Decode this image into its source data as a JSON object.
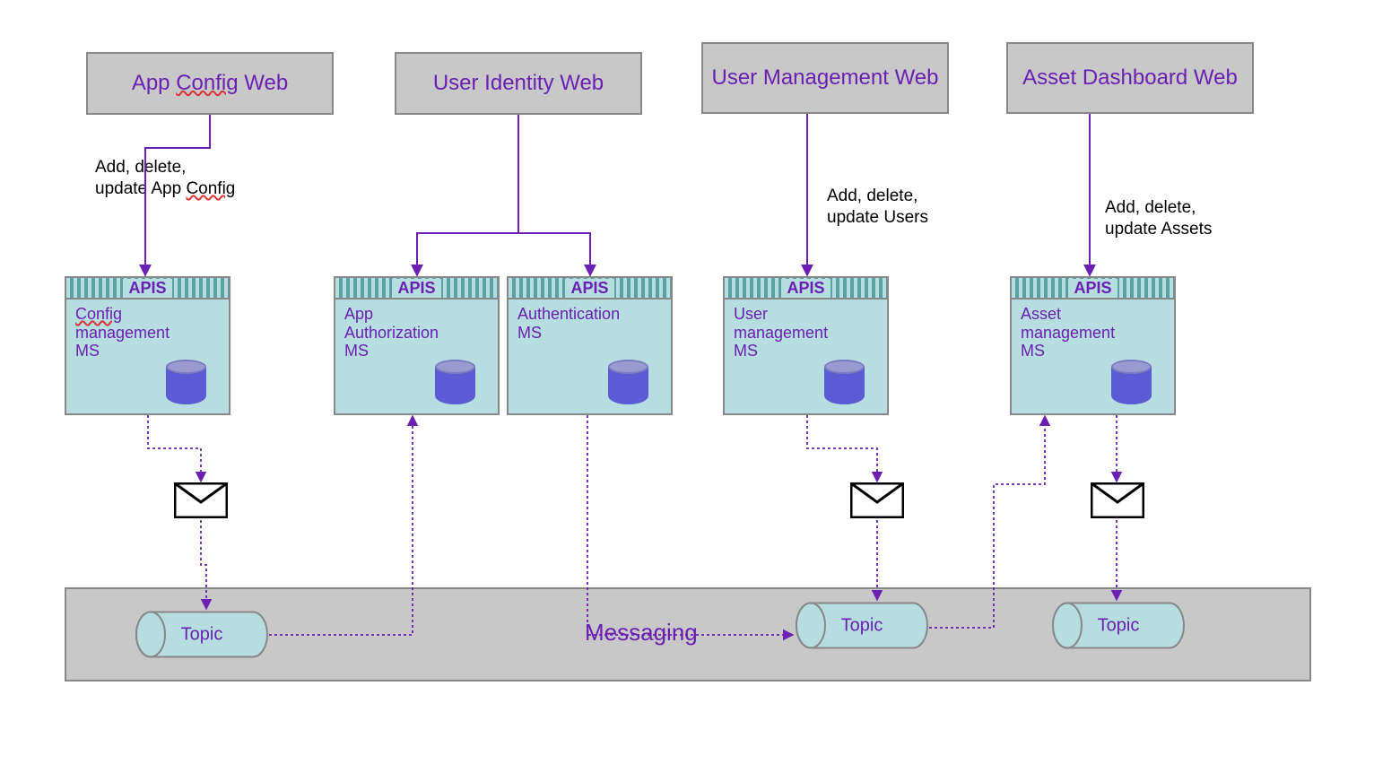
{
  "webBoxes": {
    "appConfig": "App Config Web",
    "appConfig_prefix": "App ",
    "appConfig_wavy": "Config",
    "appConfig_suffix": " Web",
    "userIdentity": "User Identity Web",
    "userMgmt": "User Management Web",
    "assetDash": "Asset Dashboard Web"
  },
  "msBoxes": {
    "apis_label": "APIS",
    "config": {
      "l1_wavy": "Config",
      "l2": "management",
      "l3": "MS"
    },
    "appAuth": {
      "l1": "App",
      "l2": "Authorization",
      "l3": "MS"
    },
    "authn": {
      "l1": "Authentication",
      "l2": "MS"
    },
    "userMgmt": {
      "l1": "User",
      "l2": "management",
      "l3": "MS"
    },
    "assetMgmt": {
      "l1": "Asset",
      "l2": "management",
      "l3": "MS"
    }
  },
  "labels": {
    "config_l1": "Add, delete,",
    "config_l2_pre": "update App ",
    "config_l2_wavy": "Config",
    "users_l1": "Add, delete,",
    "users_l2": "update Users",
    "assets_l1": "Add, delete,",
    "assets_l2": "update Assets"
  },
  "messaging": "Messaging",
  "topic_label": "Topic"
}
